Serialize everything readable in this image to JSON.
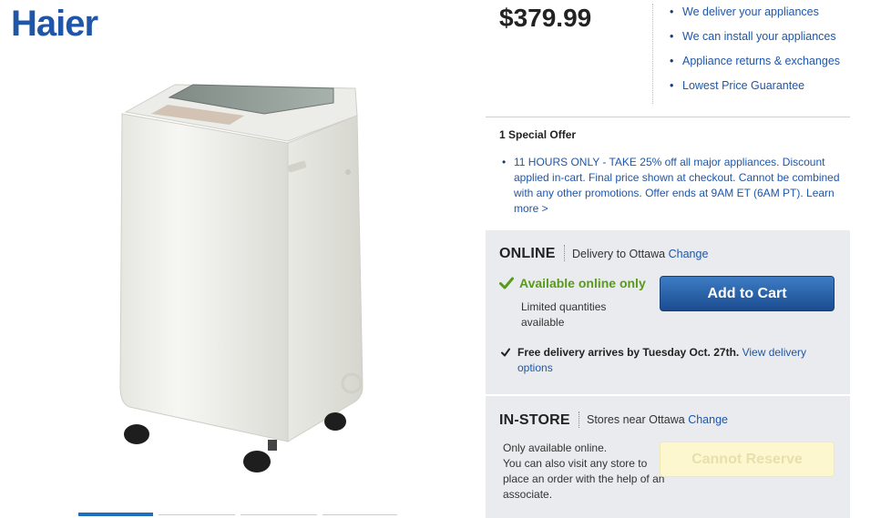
{
  "brand": {
    "logo_text": "Haier"
  },
  "product": {
    "price": "$379.99"
  },
  "services": [
    "We deliver your appliances",
    "We can install your appliances",
    "Appliance returns & exchanges",
    "Lowest Price Guarantee"
  ],
  "offer": {
    "title": "1 Special Offer",
    "text": "11 HOURS ONLY - TAKE 25% off all major appliances. Discount applied in-cart. Final price shown at checkout. Cannot be combined with any other promotions. Offer ends at 9AM ET (6AM PT).",
    "link": "Learn more >"
  },
  "online": {
    "heading": "ONLINE",
    "delivery_to": "Delivery to Ottawa",
    "change_link": "Change",
    "availability": "Available online only",
    "limited": "Limited quantities available",
    "add_to_cart": "Add to Cart",
    "delivery_bold": "Free delivery arrives by Tuesday Oct. 27th.",
    "delivery_link": "View delivery options"
  },
  "instore": {
    "heading": "IN-STORE",
    "stores_near": "Stores near Ottawa",
    "change_link": "Change",
    "note_line1": "Only available online.",
    "note_line2": "You can also visit any store to place an order with the help of an associate.",
    "reserve_button": "Cannot Reserve"
  },
  "colors": {
    "brand_blue": "#1f56a8",
    "available_green": "#5a9a1a",
    "panel_bg": "#e9ebee",
    "cart_button": "#1b4c8f",
    "reserve_disabled": "#fdf7cf"
  },
  "icons": {
    "availability": "checkmark-icon",
    "delivery": "checkmark-icon"
  }
}
